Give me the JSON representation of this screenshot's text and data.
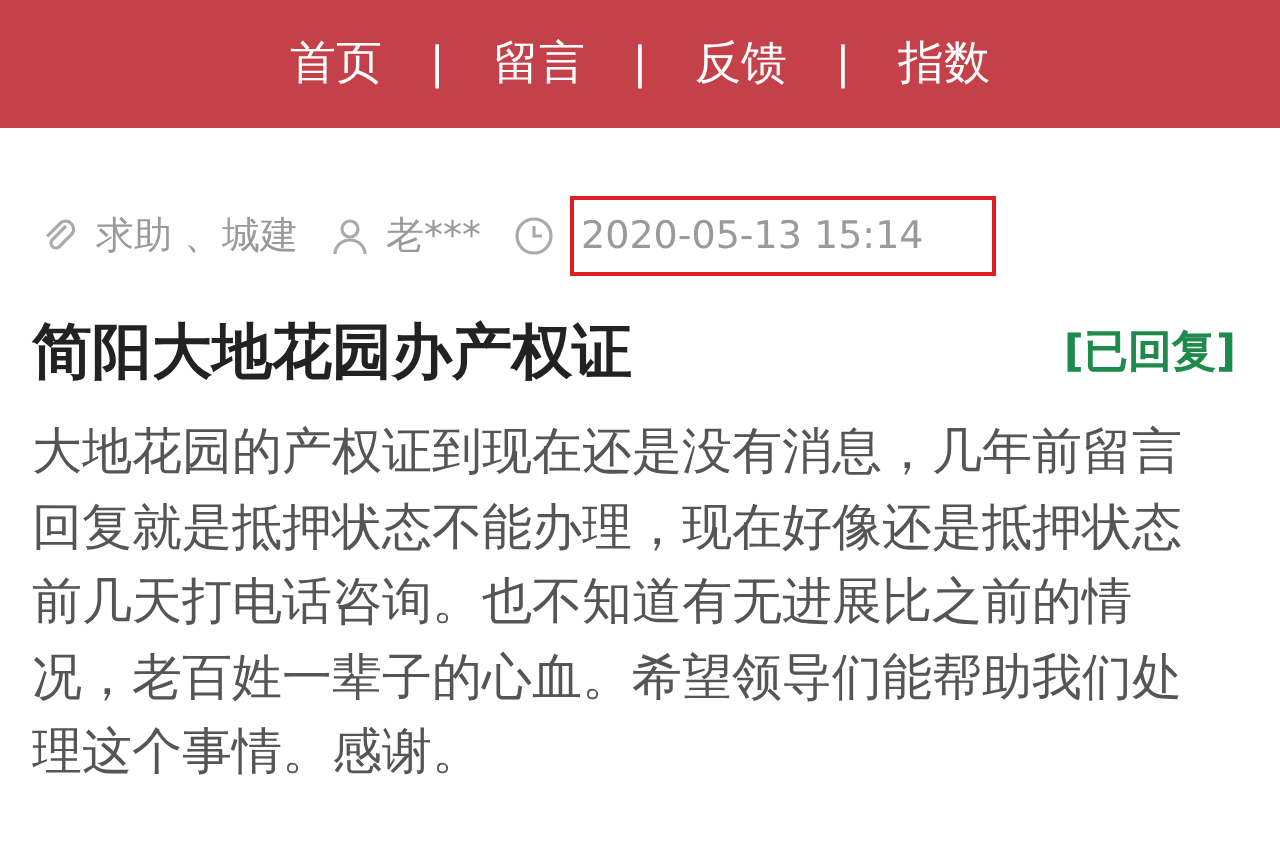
{
  "nav": [
    {
      "label": "首页"
    },
    {
      "label": "留言"
    },
    {
      "label": "反馈"
    },
    {
      "label": "指数"
    }
  ],
  "nav_separator": "|",
  "meta": {
    "category": "求助 、城建",
    "author": "老***",
    "date": "2020-05-13 15:14",
    "date_highlighted": true
  },
  "post": {
    "title": "简阳大地花园办产权证",
    "status": "[已回复]",
    "replied": true,
    "body": "大地花园的产权证到现在还是没有消息，几年前留言回复就是抵押状态不能办理，现在好像还是抵押状态前几天打电话咨询。也不知道有无进展比之前的情况，老百姓一辈子的心血。希望领导们能帮助我们处理这个事情。感谢。"
  }
}
